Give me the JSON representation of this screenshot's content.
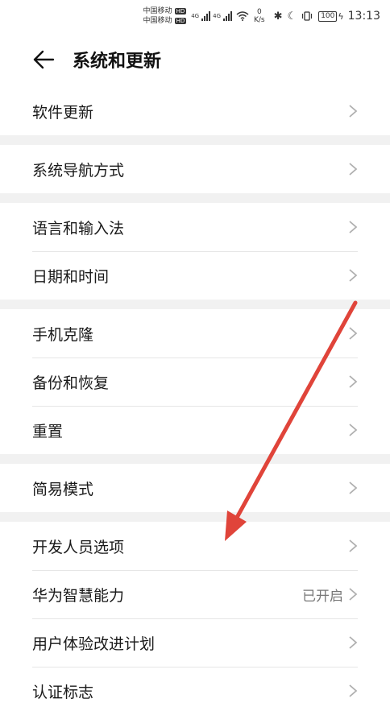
{
  "status_bar": {
    "carrier1": "中国移动",
    "carrier2": "中国移动",
    "hd": "HD",
    "net1": "4G",
    "net2": "4G",
    "speed_value": "0",
    "speed_unit": "K/s",
    "battery": "100",
    "time": "13:13"
  },
  "header": {
    "title": "系统和更新"
  },
  "groups": [
    {
      "items": [
        {
          "label": "软件更新"
        }
      ]
    },
    {
      "items": [
        {
          "label": "系统导航方式"
        }
      ]
    },
    {
      "items": [
        {
          "label": "语言和输入法"
        },
        {
          "label": "日期和时间"
        }
      ]
    },
    {
      "items": [
        {
          "label": "手机克隆"
        },
        {
          "label": "备份和恢复"
        },
        {
          "label": "重置"
        }
      ]
    },
    {
      "items": [
        {
          "label": "简易模式"
        }
      ]
    },
    {
      "items": [
        {
          "label": "开发人员选项"
        },
        {
          "label": "华为智慧能力",
          "value": "已开启"
        },
        {
          "label": "用户体验改进计划"
        },
        {
          "label": "认证标志"
        }
      ]
    }
  ],
  "colors": {
    "annotation_arrow": "#e0443a",
    "separator": "#f1f1f1",
    "chevron": "#b0b0b0"
  }
}
